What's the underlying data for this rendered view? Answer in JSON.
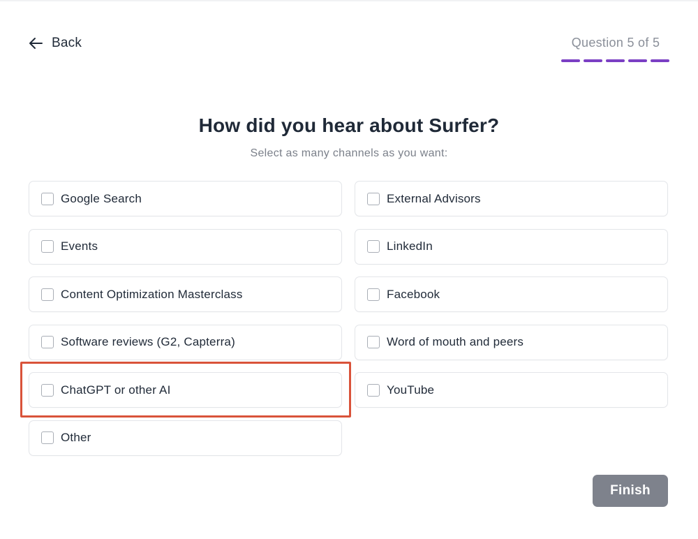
{
  "header": {
    "back_label": "Back",
    "back_icon": "arrow-left-icon",
    "progress_label": "Question 5 of 5",
    "progress": {
      "current": 5,
      "total": 5
    }
  },
  "question": {
    "title": "How did you hear about Surfer?",
    "subtitle": "Select as many channels as you want:"
  },
  "options": [
    {
      "label": "Google Search",
      "checked": false
    },
    {
      "label": "External Advisors",
      "checked": false
    },
    {
      "label": "Events",
      "checked": false
    },
    {
      "label": "LinkedIn",
      "checked": false
    },
    {
      "label": "Content Optimization Masterclass",
      "checked": false
    },
    {
      "label": "Facebook",
      "checked": false
    },
    {
      "label": "Software reviews (G2, Capterra)",
      "checked": false
    },
    {
      "label": "Word of mouth and peers",
      "checked": false
    },
    {
      "label": "ChatGPT or other AI",
      "checked": false,
      "highlighted": true
    },
    {
      "label": "YouTube",
      "checked": false
    },
    {
      "label": "Other",
      "checked": false
    }
  ],
  "footer": {
    "finish_label": "Finish"
  },
  "colors": {
    "accent": "#7c3aed",
    "progress_bar": "#7b3fc4",
    "finish_button_bg": "#7e828c",
    "highlight_border": "#d9533a",
    "text_primary": "#1f2937",
    "text_muted": "#7b808a"
  }
}
